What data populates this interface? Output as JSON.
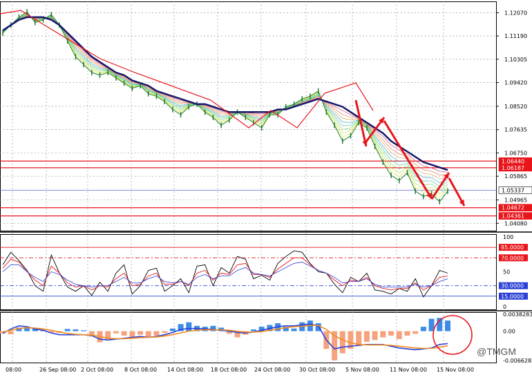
{
  "chart_data": [
    {
      "type": "line",
      "panel": "price",
      "title": "",
      "ylim": [
        1.038,
        1.125
      ],
      "grid": true,
      "price_axis_ticks": [
        "1.12070",
        "1.11190",
        "1.10305",
        "1.09420",
        "1.08520",
        "1.07635",
        "1.06750",
        "1.05865",
        "1.04965",
        "1.04080"
      ],
      "horizontal_levels": [
        {
          "value": 1.0644,
          "label": "1.06440",
          "color": "#e8151b"
        },
        {
          "value": 1.06187,
          "label": "1.06187",
          "color": "#e8151b"
        },
        {
          "value": 1.05337,
          "label": "1.05337",
          "color": "#5a6fd6"
        },
        {
          "value": 1.04672,
          "label": "1.04672",
          "color": "#e8151b"
        },
        {
          "value": 1.04361,
          "label": "1.04361",
          "color": "#e8151b"
        }
      ],
      "series": [
        {
          "role": "price",
          "values": [
            1.113,
            1.116,
            1.119,
            1.121,
            1.117,
            1.118,
            1.12,
            1.116,
            1.11,
            1.104,
            1.101,
            1.098,
            1.097,
            1.098,
            1.096,
            1.094,
            1.092,
            1.093,
            1.09,
            1.089,
            1.087,
            1.084,
            1.082,
            1.085,
            1.086,
            1.083,
            1.081,
            1.078,
            1.08,
            1.083,
            1.081,
            1.079,
            1.077,
            1.082,
            1.082,
            1.085,
            1.086,
            1.088,
            1.089,
            1.091,
            1.083,
            1.078,
            1.072,
            1.074,
            1.079,
            1.077,
            1.07,
            1.064,
            1.059,
            1.057,
            1.06,
            1.053,
            1.051,
            1.052,
            1.049,
            1.053
          ]
        },
        {
          "role": "moving-average",
          "values": [
            1.114,
            1.116,
            1.118,
            1.119,
            1.119,
            1.119,
            1.118,
            1.116,
            1.113,
            1.11,
            1.107,
            1.104,
            1.102,
            1.1,
            1.098,
            1.097,
            1.095,
            1.094,
            1.093,
            1.091,
            1.09,
            1.089,
            1.088,
            1.087,
            1.086,
            1.086,
            1.085,
            1.084,
            1.083,
            1.083,
            1.083,
            1.083,
            1.083,
            1.083,
            1.084,
            1.084,
            1.085,
            1.086,
            1.087,
            1.088,
            1.087,
            1.086,
            1.085,
            1.083,
            1.081,
            1.079,
            1.077,
            1.075,
            1.072,
            1.07,
            1.068,
            1.066,
            1.064,
            1.063,
            1.062,
            1.061
          ]
        }
      ],
      "colors": {
        "price": "#1f7a35",
        "ma": "#15186b",
        "level": "#e8151b",
        "current": "#5a6fd6",
        "annotation": "#e8151b"
      }
    },
    {
      "type": "line",
      "panel": "oscillator",
      "ylim": [
        0,
        100
      ],
      "axis_ticks": [
        "100",
        "50",
        "0"
      ],
      "levels": [
        {
          "value": 85,
          "label": "85.0000",
          "color": "#e8151b"
        },
        {
          "value": 70,
          "label": "70.0000",
          "color": "#e8151b"
        },
        {
          "value": 30,
          "label": "30.0000",
          "color": "#2a3fd6"
        },
        {
          "value": 15,
          "label": "15.0000",
          "color": "#2a3fd6"
        }
      ],
      "series": [
        {
          "role": "fast",
          "color": "#000000",
          "values": [
            60,
            78,
            66,
            52,
            30,
            22,
            74,
            48,
            28,
            22,
            30,
            16,
            35,
            22,
            48,
            60,
            18,
            30,
            52,
            55,
            22,
            30,
            40,
            20,
            58,
            60,
            30,
            56,
            48,
            72,
            68,
            40,
            45,
            38,
            62,
            72,
            80,
            78,
            62,
            50,
            48,
            32,
            20,
            42,
            36,
            48,
            24,
            22,
            18,
            26,
            22,
            40,
            14,
            30,
            52,
            48
          ]
        },
        {
          "role": "middle",
          "color": "#e8151b",
          "values": [
            55,
            68,
            64,
            50,
            38,
            30,
            58,
            48,
            34,
            28,
            30,
            24,
            30,
            28,
            40,
            48,
            30,
            32,
            44,
            48,
            32,
            32,
            36,
            30,
            48,
            52,
            38,
            48,
            46,
            60,
            62,
            46,
            46,
            42,
            54,
            62,
            70,
            70,
            60,
            52,
            48,
            38,
            30,
            38,
            36,
            42,
            30,
            26,
            24,
            26,
            26,
            34,
            24,
            30,
            42,
            44
          ]
        },
        {
          "role": "slow",
          "color": "#3b4fd8",
          "values": [
            50,
            60,
            60,
            50,
            42,
            36,
            50,
            46,
            38,
            32,
            30,
            28,
            30,
            30,
            36,
            42,
            34,
            34,
            40,
            44,
            36,
            34,
            36,
            32,
            42,
            46,
            40,
            44,
            44,
            52,
            56,
            48,
            46,
            44,
            50,
            56,
            62,
            64,
            58,
            52,
            48,
            42,
            34,
            36,
            36,
            40,
            32,
            28,
            28,
            28,
            28,
            32,
            28,
            30,
            36,
            40
          ]
        }
      ]
    },
    {
      "type": "bar",
      "panel": "macd",
      "axis_ticks": [
        "0.0038283",
        "0.00",
        "-0.0066283"
      ],
      "ylim": [
        -0.0066283,
        0.0038283
      ],
      "histogram": [
        -0.0005,
        -0.0007,
        0.0008,
        0.0007,
        0.0005,
        0.0002,
        -0.0003,
        -0.0004,
        0.0005,
        0.0004,
        0.0002,
        -0.0012,
        -0.0025,
        -0.0018,
        -0.0005,
        -0.001,
        -0.0016,
        -0.0008,
        -0.0014,
        -0.001,
        -0.0004,
        0.0006,
        0.0016,
        0.002,
        0.0012,
        0.001,
        0.0012,
        0.0008,
        -0.0006,
        -0.0014,
        -0.0008,
        0.0004,
        0.001,
        0.0014,
        0.0018,
        0.001,
        0.0006,
        0.002,
        0.0024,
        0.0018,
        -0.004,
        -0.0066,
        -0.005,
        -0.004,
        -0.0034,
        -0.0024,
        -0.002,
        -0.0014,
        -0.001,
        -0.0018,
        -0.001,
        -0.0006,
        0.001,
        0.0028,
        0.003,
        0.0024
      ],
      "series": [
        {
          "role": "macd",
          "color": "#2a3fd6",
          "values": [
            -0.0005,
            0.0005,
            0.0012,
            0.001,
            0.0005,
            0.0002,
            -0.0004,
            -0.0008,
            -0.0008,
            -0.0008,
            -0.0008,
            -0.001,
            -0.0018,
            -0.002,
            -0.0018,
            -0.0016,
            -0.0014,
            -0.0012,
            -0.0014,
            -0.0012,
            -0.0008,
            -0.0003,
            0.0004,
            0.0006,
            0.0006,
            0.0005,
            0.0004,
            0.0002,
            0.0,
            -0.0003,
            -0.0004,
            -0.0002,
            0.0002,
            0.0006,
            0.001,
            0.0012,
            0.0012,
            0.0014,
            0.0016,
            0.0012,
            -0.002,
            -0.004,
            -0.0036,
            -0.0034,
            -0.0032,
            -0.003,
            -0.003,
            -0.003,
            -0.0034,
            -0.0038,
            -0.004,
            -0.0042,
            -0.004,
            -0.0038,
            -0.003,
            -0.0028
          ]
        },
        {
          "role": "signal",
          "color": "#f28c20",
          "values": [
            -0.0002,
            0.0002,
            0.0006,
            0.0008,
            0.0007,
            0.0005,
            0.0002,
            -0.0002,
            -0.0005,
            -0.0007,
            -0.0008,
            -0.0009,
            -0.0012,
            -0.0016,
            -0.0017,
            -0.0017,
            -0.0016,
            -0.0015,
            -0.0014,
            -0.0013,
            -0.0011,
            -0.0008,
            -0.0004,
            0.0,
            0.0002,
            0.0003,
            0.0003,
            0.0003,
            0.0002,
            0.0,
            -0.0002,
            -0.0002,
            -0.0001,
            0.0002,
            0.0005,
            0.0008,
            0.001,
            0.0011,
            0.0013,
            0.0013,
            0.0004,
            -0.001,
            -0.002,
            -0.0026,
            -0.003,
            -0.0031,
            -0.0031,
            -0.0031,
            -0.0032,
            -0.0034,
            -0.0036,
            -0.0038,
            -0.0039,
            -0.0039,
            -0.0036,
            -0.0033
          ]
        }
      ],
      "colors": {
        "positive": "#3d8be6",
        "negative": "#f5a37f"
      }
    }
  ],
  "x_axis_ticks": [
    "08:00",
    "26 Sep 08:00",
    "2 Oct 08:00",
    "8 Oct 08:00",
    "14 Oct 08:00",
    "18 Oct 08:00",
    "24 Oct 08:00",
    "30 Oct 08:00",
    "5 Nov 08:00",
    "11 Nov 08:00",
    "15 Nov 08:00"
  ],
  "watermark": "@TMGM"
}
